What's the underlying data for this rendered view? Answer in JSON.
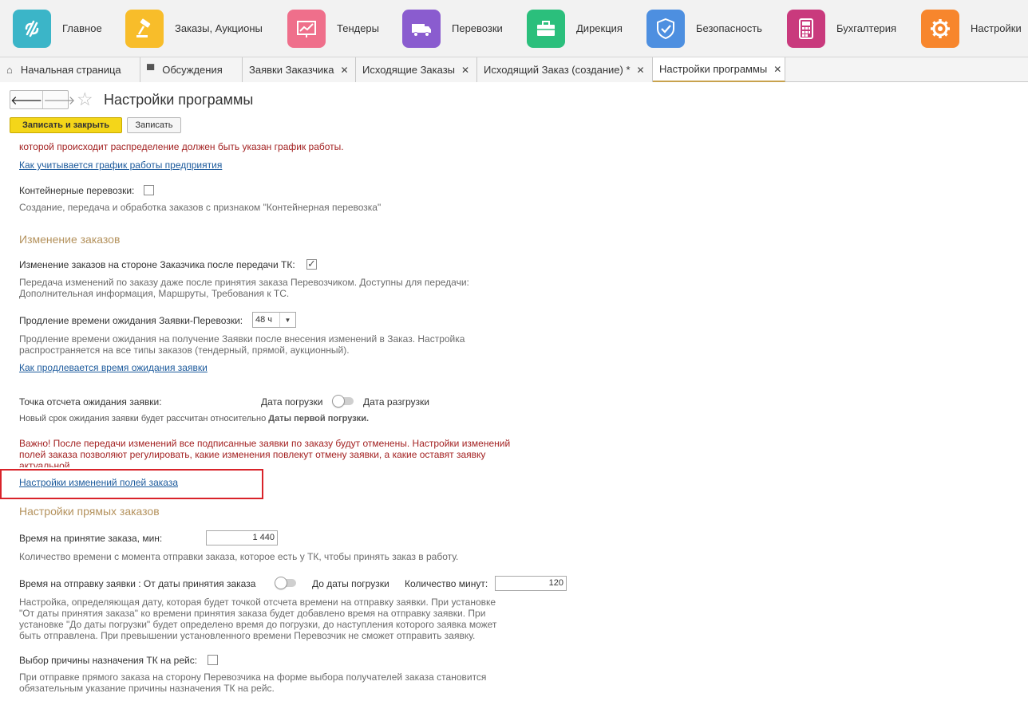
{
  "topnav": {
    "items": [
      {
        "label": "Главное",
        "icon": "home-logo-icon",
        "color": "#3bb5c8"
      },
      {
        "label": "Заказы, Аукционы",
        "icon": "gavel-icon",
        "color": "#f8bd2a"
      },
      {
        "label": "Тендеры",
        "icon": "chart-board-icon",
        "color": "#ef6f8b"
      },
      {
        "label": "Перевозки",
        "icon": "truck-icon",
        "color": "#8a5ccf"
      },
      {
        "label": "Дирекция",
        "icon": "briefcase-icon",
        "color": "#2bbf7c"
      },
      {
        "label": "Безопасность",
        "icon": "shield-check-icon",
        "color": "#4d8fe0"
      },
      {
        "label": "Бухгалтерия",
        "icon": "calculator-icon",
        "color": "#c93a7d"
      },
      {
        "label": "Настройки",
        "icon": "gear-icon",
        "color": "#f7862d"
      }
    ]
  },
  "tabs": [
    {
      "label": "Начальная страница",
      "icon": "home-icon"
    },
    {
      "label": "Обсуждения",
      "icon": "chat-icon"
    },
    {
      "label": "Заявки Заказчика",
      "close": "✕"
    },
    {
      "label": "Исходящие Заказы",
      "close": "✕"
    },
    {
      "label": "Исходящий Заказ (создание) *",
      "close": "✕"
    },
    {
      "label": "Настройки программы",
      "close": "✕"
    }
  ],
  "form": {
    "title": "Настройки программы",
    "save_close_label": "Записать и закрыть",
    "save_label": "Записать"
  },
  "content": {
    "top_warning": "которой происходит распределение должен быть указан график работы.",
    "schedule_link": "Как учитывается график работы предприятия",
    "container_label": "Контейнерные перевозки:",
    "container_checked": false,
    "container_desc": "Создание, передача и обработка заказов с признаком \"Контейнерная перевозка\"",
    "section_change": "Изменение заказов",
    "change_label": "Изменение заказов на стороне Заказчика после передачи ТК:",
    "change_checked": true,
    "change_desc_1": "Передача изменений по заказу даже после принятия заказа Перевозчиком. Доступны для передачи:",
    "change_desc_2": "Дополнительная информация, Маршруты, Требования к ТС.",
    "extend_label": "Продление времени ожидания Заявки-Перевозки:",
    "extend_value": "48 ч",
    "extend_desc_1": "Продление времени ожидания на получение Заявки после внесения изменений в Заказ. Настройка",
    "extend_desc_2": "распространяется на все типы заказов (тендерный, прямой, аукционный).",
    "extend_link": "Как продлевается время ожидания заявки",
    "point_label": "Точка отсчета ожидания заявки:",
    "point_opt_left": "Дата погрузки",
    "point_opt_right": "Дата разгрузки",
    "point_note_prefix": "Новый срок ожидания заявки будет рассчитан относительно",
    "point_note_bold": "Даты первой погрузки.",
    "important_1": "Важно! После передачи изменений все подписанные заявки по заказу будут отменены. Настройки изменений",
    "important_2": "полей заказа позволяют регулировать, какие изменения повлекут отмену заявки, а какие оставят заявку",
    "important_3": "актуальной.",
    "fields_link": "Настройки изменений полей заказа",
    "section_direct": "Настройки прямых заказов",
    "accept_label": "Время на принятие заказа, мин:",
    "accept_value": "1 440",
    "accept_desc": "Количество времени с момента отправки заказа, которое есть у ТК, чтобы принять заказ в работу.",
    "send_label": "Время на отправку заявки : От даты принятия заказа",
    "send_opt_right": "До даты погрузки",
    "minutes_label": "Количество минут:",
    "minutes_value": "120",
    "send_desc_1": "Настройка, определяющая дату, которая будет точкой отсчета времени на отправку заявки. При установке",
    "send_desc_2": "\"От даты принятия заказа\" ко времени принятия заказа будет добавлено время на отправку заявки. При",
    "send_desc_3": "установке \"До даты погрузки\" будет определено время до погрузки, до наступления которого заявка может",
    "send_desc_4": "быть отправлена. При превышении установленного времени Перевозчик не сможет отправить заявку.",
    "reason_label": "Выбор причины назначения ТК на рейс:",
    "reason_checked": false,
    "reason_desc_1": "При отправке прямого заказа на сторону Перевозчика на форме выбора получателей заказа становится",
    "reason_desc_2": "обязательным указание причины назначения ТК на рейс."
  }
}
